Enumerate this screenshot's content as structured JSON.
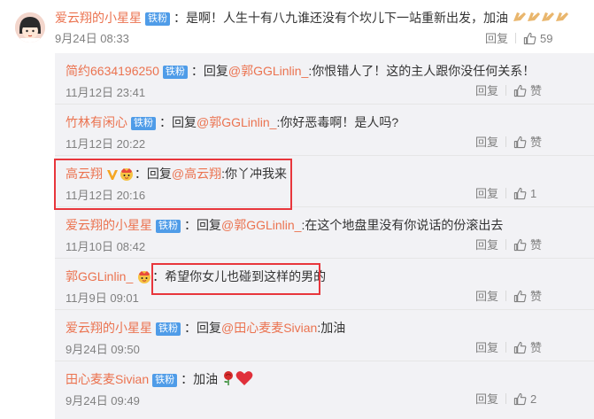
{
  "main_comment": {
    "user": "爱云翔的小星星",
    "badge": "铁粉",
    "text": "：是啊！人生十有八九谁还没有个坎儿下一站重新出发，加油",
    "date": "9月24日 08:33",
    "reply_label": "回复",
    "like_count": "59"
  },
  "replies": [
    {
      "user": "简约6634196250",
      "badge": "铁粉",
      "prefix": "：回复",
      "mention": "@郭GGLinlin_",
      "text": ":你恨错人了！这的主人跟你没任何关系！",
      "date": "11月12日 23:41",
      "reply_label": "回复",
      "like": "赞"
    },
    {
      "user": "竹林有闲心",
      "badge": "铁粉",
      "prefix": "：回复",
      "mention": "@郭GGLinlin_",
      "text": ":你好恶毒啊！是人吗?",
      "date": "11月12日 20:22",
      "reply_label": "回复",
      "like": "赞"
    },
    {
      "user": "高云翔",
      "badge": "",
      "prefix": "：回复",
      "mention": "@高云翔",
      "text": ":你丫冲我来",
      "date": "11月12日 20:16",
      "reply_label": "回复",
      "like": "1"
    },
    {
      "user": "爱云翔的小星星",
      "badge": "铁粉",
      "prefix": "：回复",
      "mention": "@郭GGLinlin_",
      "text": ":在这个地盘里没有你说话的份滚出去",
      "date": "11月10日 08:42",
      "reply_label": "回复",
      "like": "赞"
    },
    {
      "user": "郭GGLinlin_",
      "badge": "",
      "prefix": "：",
      "mention": "",
      "text": "希望你女儿也碰到这样的男的",
      "date": "11月9日 09:01",
      "reply_label": "回复",
      "like": "赞"
    },
    {
      "user": "爱云翔的小星星",
      "badge": "铁粉",
      "prefix": "：回复",
      "mention": "@田心麦麦Sivian",
      "text": ":加油",
      "date": "9月24日 09:50",
      "reply_label": "回复",
      "like": "赞"
    },
    {
      "user": "田心麦麦Sivian",
      "badge": "铁粉",
      "prefix": "：",
      "mention": "",
      "text": "加油",
      "date": "9月24日 09:49",
      "reply_label": "回复",
      "like": "2"
    }
  ],
  "colors": {
    "username": "#eb7350",
    "badge": "#4f9ce8",
    "highlight": "#e8363c",
    "reply_bg": "#f2f2f5"
  },
  "icons": [
    "avatar-cartoon-girl",
    "thumbs-up-icon",
    "clap-emoji",
    "verified-v-icon",
    "crown-emoji",
    "rose-emoji",
    "heart-emoji"
  ]
}
